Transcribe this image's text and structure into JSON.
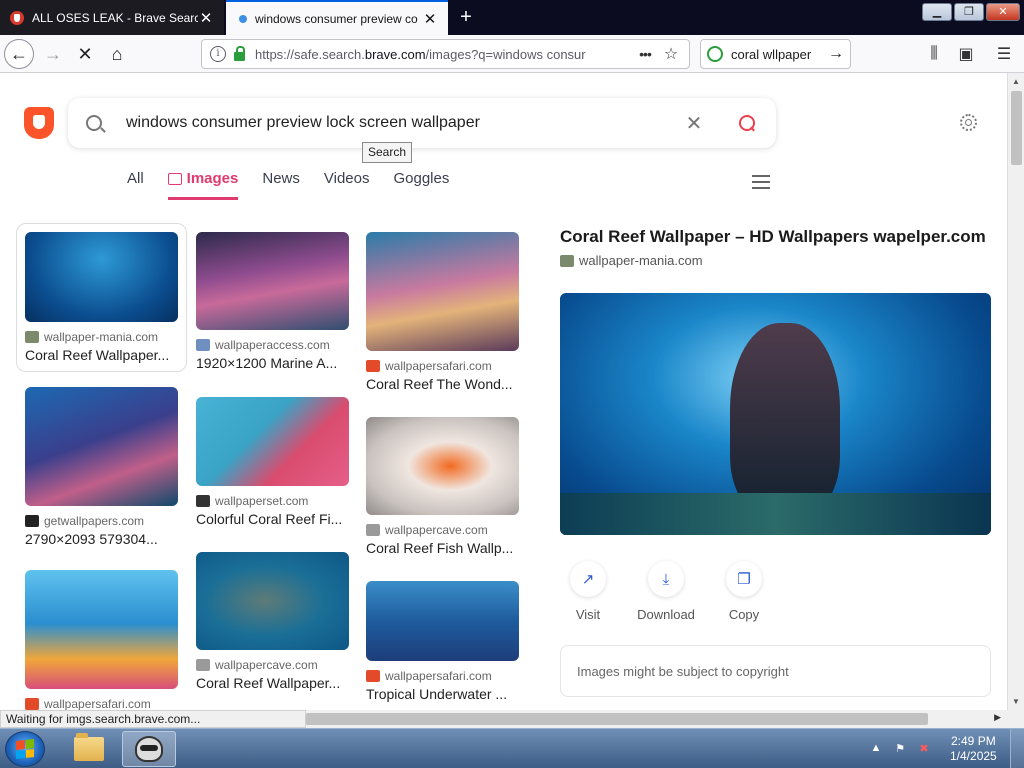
{
  "browser": {
    "tabs": [
      {
        "title": "ALL OSES LEAK - Brave Search",
        "active": false
      },
      {
        "title": "windows consumer preview co",
        "active": true
      }
    ],
    "url": {
      "prefix": "https://safe.search.",
      "domain": "brave.com",
      "rest": "/images?q=windows consur"
    },
    "search_bar_query": "coral wllpaper",
    "window_buttons": [
      "minimize",
      "restore",
      "close"
    ]
  },
  "search": {
    "query": "windows consumer preview lock screen wallpaper",
    "tooltip": "Search"
  },
  "verticals": [
    {
      "label": "All",
      "active": false
    },
    {
      "label": "Images",
      "active": true
    },
    {
      "label": "News",
      "active": false
    },
    {
      "label": "Videos",
      "active": false
    },
    {
      "label": "Goggles",
      "active": false
    }
  ],
  "results": [
    {
      "source": "wallpaper-mania.com",
      "caption": "Coral Reef Wallpaper...",
      "selected": true
    },
    {
      "source": "getwallpapers.com",
      "caption": "2790×2093 579304..."
    },
    {
      "source": "wallpapersafari.com",
      "caption": ""
    },
    {
      "source": "wallpaperaccess.com",
      "caption": "1920×1200 Marine A..."
    },
    {
      "source": "wallpaperset.com",
      "caption": "Colorful Coral Reef Fi..."
    },
    {
      "source": "wallpapercave.com",
      "caption": "Coral Reef Wallpaper..."
    },
    {
      "source": "wallpapersafari.com",
      "caption": "Coral Reef The Wond..."
    },
    {
      "source": "wallpapercave.com",
      "caption": "Coral Reef Fish Wallp..."
    },
    {
      "source": "wallpapersafari.com",
      "caption": "Tropical Underwater ..."
    }
  ],
  "preview": {
    "title": "Coral Reef Wallpaper – HD Wallpapers wapelper.com",
    "source": "wallpaper-mania.com",
    "actions": [
      "Visit",
      "Download",
      "Copy"
    ],
    "note": "Images might be subject to copyright"
  },
  "status": "Waiting for imgs.search.brave.com...",
  "taskbar": {
    "time": "2:49 PM",
    "date": "1/4/2025"
  },
  "colors": {
    "brave_accent": "#df3b6f",
    "brave_logo": "#fb542b",
    "tab_indicator": "#0060df"
  }
}
